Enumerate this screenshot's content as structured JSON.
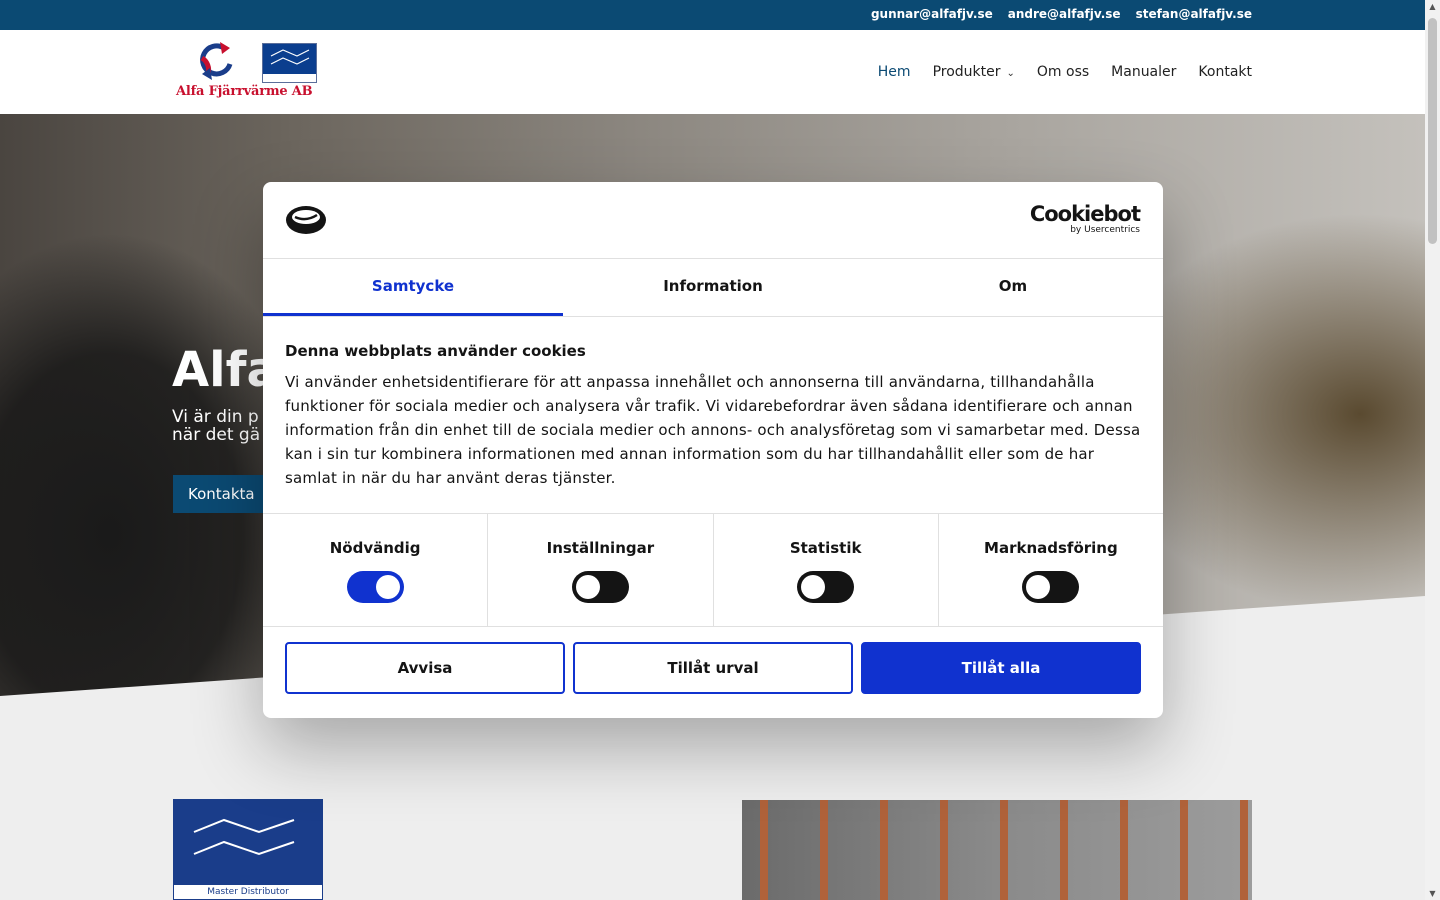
{
  "topbar": {
    "emails": [
      "gunnar@alfafjv.se",
      "andre@alfafjv.se",
      "stefan@alfafjv.se"
    ]
  },
  "header": {
    "logo_text": "Alfa Fjärrvärme AB",
    "nav": {
      "home": "Hem",
      "products": "Produkter",
      "about": "Om oss",
      "manuals": "Manualer",
      "contact": "Kontakt"
    }
  },
  "hero": {
    "title": "Alfa",
    "subtitle_line1": "Vi är din p",
    "subtitle_line2": "när det gä",
    "button": "Kontakta"
  },
  "lower": {
    "card_sub": "Master Distributor"
  },
  "cookie_dialog": {
    "brand": "Cookiebot",
    "brand_sub": "by Usercentrics",
    "tabs": [
      "Samtycke",
      "Information",
      "Om"
    ],
    "active_tab": "Samtycke",
    "heading": "Denna webbplats använder cookies",
    "body": "Vi använder enhetsidentifierare för att anpassa innehållet och annonserna till användarna, tillhandahålla funktioner för sociala medier och analysera vår trafik. Vi vidarebefordrar även sådana identifierare och annan information från din enhet till de sociala medier och annons- och analysföretag som vi samarbetar med. Dessa kan i sin tur kombinera informationen med annan information som du har tillhandahållit eller som de har samlat in när du har använt deras tjänster.",
    "categories": [
      {
        "label": "Nödvändig",
        "enabled": true
      },
      {
        "label": "Inställningar",
        "enabled": false
      },
      {
        "label": "Statistik",
        "enabled": false
      },
      {
        "label": "Marknadsföring",
        "enabled": false
      }
    ],
    "buttons": {
      "deny": "Avvisa",
      "allow_selection": "Tillåt urval",
      "allow_all": "Tillåt alla"
    },
    "colors": {
      "accent": "#1032cf",
      "dark": "#141414"
    }
  },
  "colors": {
    "brand_blue": "#0b4a73",
    "logo_red": "#c8102e"
  }
}
